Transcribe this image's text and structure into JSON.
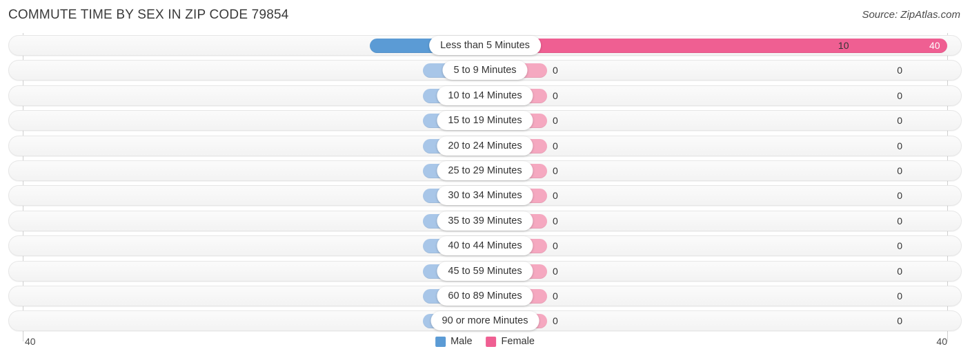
{
  "header": {
    "title": "COMMUTE TIME BY SEX IN ZIP CODE 79854",
    "source": "Source: ZipAtlas.com"
  },
  "legend": {
    "male_label": "Male",
    "female_label": "Female",
    "male_color": "#5b9bd5",
    "female_color": "#ef5f92",
    "male_zero_color": "#a8c6e8",
    "female_zero_color": "#f5a8c0"
  },
  "axis": {
    "left_label": "40",
    "right_label": "40",
    "max": 40
  },
  "chart_data": {
    "type": "bar",
    "title": "COMMUTE TIME BY SEX IN ZIP CODE 79854",
    "subtitle": "Source: ZipAtlas.com",
    "orientation": "horizontal-diverging",
    "xlabel": "",
    "ylabel": "",
    "xlim": [
      40,
      40
    ],
    "grid": false,
    "legend_position": "bottom-center",
    "categories": [
      "Less than 5 Minutes",
      "5 to 9 Minutes",
      "10 to 14 Minutes",
      "15 to 19 Minutes",
      "20 to 24 Minutes",
      "25 to 29 Minutes",
      "30 to 34 Minutes",
      "35 to 39 Minutes",
      "40 to 44 Minutes",
      "45 to 59 Minutes",
      "60 to 89 Minutes",
      "90 or more Minutes"
    ],
    "series": [
      {
        "name": "Male",
        "direction": "left",
        "values": [
          10,
          0,
          0,
          0,
          0,
          0,
          0,
          0,
          0,
          0,
          0,
          0
        ]
      },
      {
        "name": "Female",
        "direction": "right",
        "values": [
          40,
          0,
          0,
          0,
          0,
          0,
          0,
          0,
          0,
          0,
          0,
          0
        ]
      }
    ],
    "rows": [
      {
        "label": "Less than 5 Minutes",
        "male": "10",
        "female": "40"
      },
      {
        "label": "5 to 9 Minutes",
        "male": "0",
        "female": "0"
      },
      {
        "label": "10 to 14 Minutes",
        "male": "0",
        "female": "0"
      },
      {
        "label": "15 to 19 Minutes",
        "male": "0",
        "female": "0"
      },
      {
        "label": "20 to 24 Minutes",
        "male": "0",
        "female": "0"
      },
      {
        "label": "25 to 29 Minutes",
        "male": "0",
        "female": "0"
      },
      {
        "label": "30 to 34 Minutes",
        "male": "0",
        "female": "0"
      },
      {
        "label": "35 to 39 Minutes",
        "male": "0",
        "female": "0"
      },
      {
        "label": "40 to 44 Minutes",
        "male": "0",
        "female": "0"
      },
      {
        "label": "45 to 59 Minutes",
        "male": "0",
        "female": "0"
      },
      {
        "label": "60 to 89 Minutes",
        "male": "0",
        "female": "0"
      },
      {
        "label": "90 or more Minutes",
        "male": "0",
        "female": "0"
      }
    ]
  }
}
